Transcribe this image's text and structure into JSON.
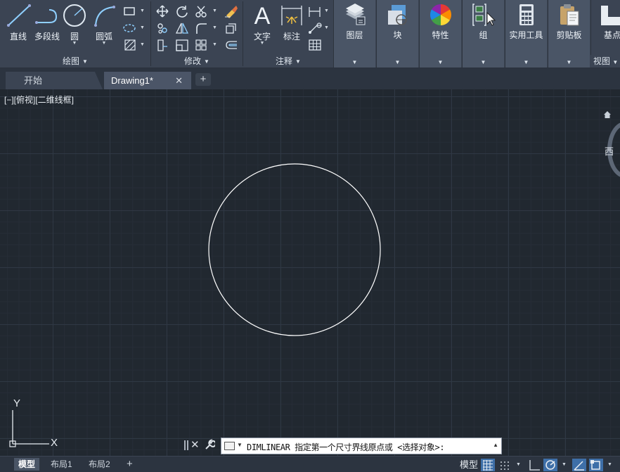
{
  "ribbon": {
    "draw_panel": {
      "title": "绘图",
      "tools": [
        {
          "id": "line",
          "label": "直线",
          "icon": "line-icon"
        },
        {
          "id": "polyline",
          "label": "多段线",
          "icon": "polyline-icon"
        },
        {
          "id": "circle",
          "label": "圆",
          "icon": "circle-icon"
        },
        {
          "id": "arc",
          "label": "圆弧",
          "icon": "arc-icon"
        }
      ],
      "small_tools": [
        "rectangle-icon",
        "ellipse-icon",
        "hatch-icon"
      ]
    },
    "modify_panel": {
      "title": "修改",
      "small_tools": [
        "move-icon",
        "rotate-icon",
        "trim-icon",
        "erase-icon",
        "copy-icon",
        "mirror-icon",
        "fillet-icon",
        "explode-icon",
        "stretch-icon",
        "scale-icon",
        "array-icon",
        "offset-icon"
      ]
    },
    "annotation_panel": {
      "title": "注释",
      "tools": [
        {
          "id": "text",
          "label": "文字",
          "icon": "text-icon"
        },
        {
          "id": "dimension",
          "label": "标注",
          "icon": "dimension-icon"
        }
      ],
      "small_tools": [
        "linear-dim-icon",
        "leader-icon",
        "table-icon"
      ]
    },
    "groups": [
      {
        "id": "layers",
        "label": "图层",
        "icon": "layers-icon"
      },
      {
        "id": "block",
        "label": "块",
        "icon": "block-icon"
      },
      {
        "id": "properties",
        "label": "特性",
        "icon": "properties-icon"
      },
      {
        "id": "group",
        "label": "组",
        "icon": "group-icon"
      },
      {
        "id": "utilities",
        "label": "实用工具",
        "icon": "calculator-icon"
      },
      {
        "id": "clipboard",
        "label": "剪贴板",
        "icon": "clipboard-icon"
      },
      {
        "id": "base",
        "label": "基点",
        "icon": "base-icon"
      }
    ],
    "view_panel": {
      "title": "视图"
    }
  },
  "tabs": {
    "start": "开始",
    "drawing": "Drawing1*",
    "close": "✕",
    "add": "+"
  },
  "canvas": {
    "viewport_label": "[−][俯视][二维线框]",
    "viewcube_west": "西",
    "ucs_x": "X",
    "ucs_y": "Y"
  },
  "command_line": {
    "text": "DIMLINEAR 指定第一个尺寸界线原点或 <选择对象>:"
  },
  "statusbar": {
    "layouts": [
      "模型",
      "布局1",
      "布局2"
    ],
    "add": "+",
    "model_space": "模型"
  },
  "colors": {
    "ribbon_bg": "#3b4453",
    "canvas_bg": "#212830",
    "accent_blue": "#3e6fa8",
    "circle_stroke": "#ffffff"
  }
}
